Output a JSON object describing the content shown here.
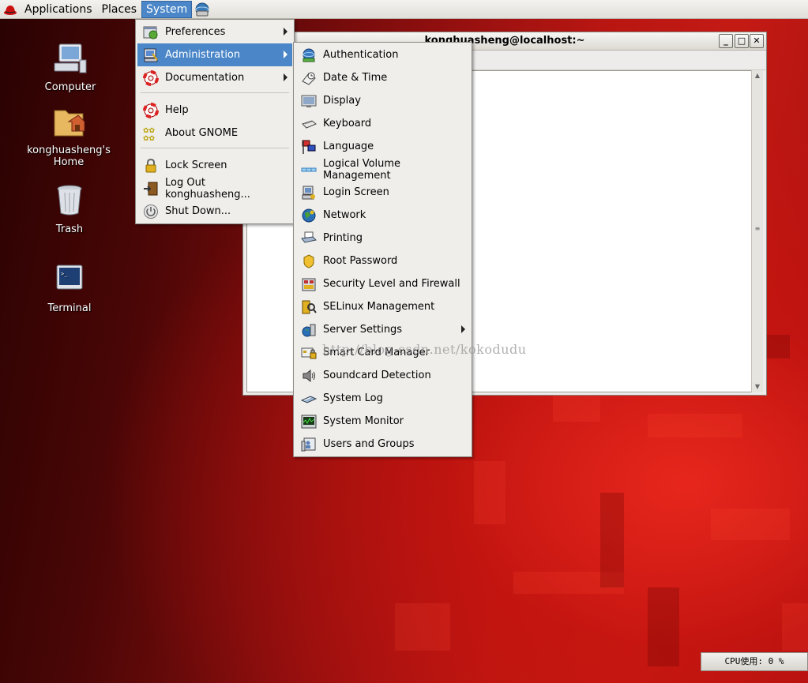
{
  "top_panel": {
    "applications": "Applications",
    "places": "Places",
    "system": "System"
  },
  "desktop_icons": [
    {
      "label": "Computer"
    },
    {
      "label": "konghuasheng's Home"
    },
    {
      "label": "Trash"
    },
    {
      "label": "Terminal"
    }
  ],
  "terminal": {
    "title": "konghuasheng@localhost:~"
  },
  "system_menu": {
    "items": [
      {
        "label": "Preferences"
      },
      {
        "label": "Administration"
      },
      {
        "label": "Documentation"
      },
      {
        "label": "Help"
      },
      {
        "label": "About GNOME"
      },
      {
        "label": "Lock Screen"
      },
      {
        "label": "Log Out konghuasheng..."
      },
      {
        "label": "Shut Down..."
      }
    ]
  },
  "admin_menu": {
    "items": [
      {
        "label": "Authentication"
      },
      {
        "label": "Date & Time"
      },
      {
        "label": "Display"
      },
      {
        "label": "Keyboard"
      },
      {
        "label": "Language"
      },
      {
        "label": "Logical Volume Management"
      },
      {
        "label": "Login Screen"
      },
      {
        "label": "Network"
      },
      {
        "label": "Printing"
      },
      {
        "label": "Root Password"
      },
      {
        "label": "Security Level and Firewall"
      },
      {
        "label": "SELinux Management"
      },
      {
        "label": "Server Settings"
      },
      {
        "label": "Smart Card Manager"
      },
      {
        "label": "Soundcard Detection"
      },
      {
        "label": "System Log"
      },
      {
        "label": "System Monitor"
      },
      {
        "label": "Users and Groups"
      }
    ]
  },
  "watermark": "http://blog.csdn.net/kokodudu",
  "cpu_applet": "CPU使用: 0 %",
  "colors": {
    "highlight": "#4a86c8",
    "menu_bg": "#efeeeb"
  }
}
